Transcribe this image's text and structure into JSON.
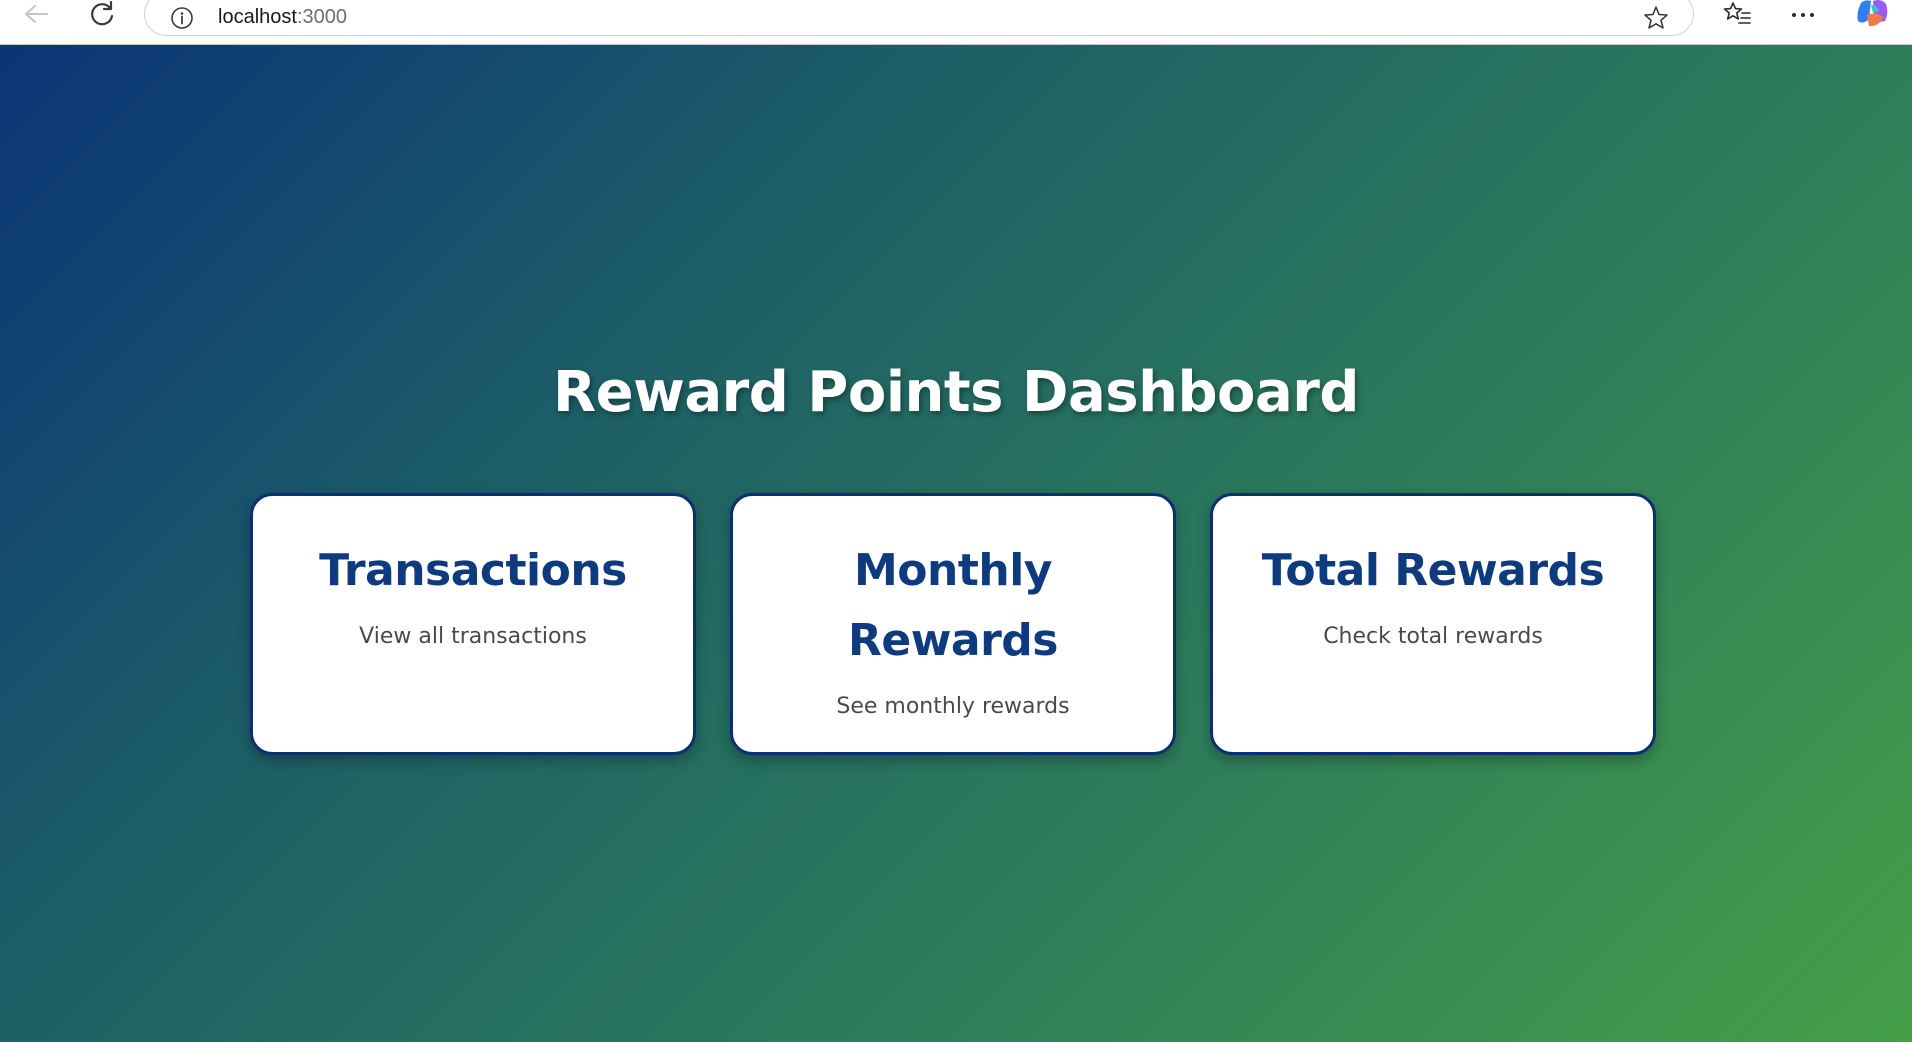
{
  "browser": {
    "url_host": "localhost",
    "url_port": ":3000",
    "icons": {
      "back": "arrow-left-icon",
      "reload": "reload-icon",
      "info": "info-icon",
      "favorite": "star-icon",
      "favorites_list": "favorites-list-icon",
      "more": "more-horizontal-icon",
      "copilot": "copilot-icon"
    }
  },
  "page": {
    "title": "Reward Points Dashboard",
    "colors": {
      "gradient_start": "#0b3478",
      "gradient_end": "#449f48",
      "card_title": "#0e3a7e",
      "card_border": "#0b2f70"
    }
  },
  "cards": [
    {
      "title": "Transactions",
      "description": "View all transactions"
    },
    {
      "title": "Monthly Rewards",
      "description": "See monthly rewards"
    },
    {
      "title": "Total Rewards",
      "description": "Check total rewards"
    }
  ]
}
